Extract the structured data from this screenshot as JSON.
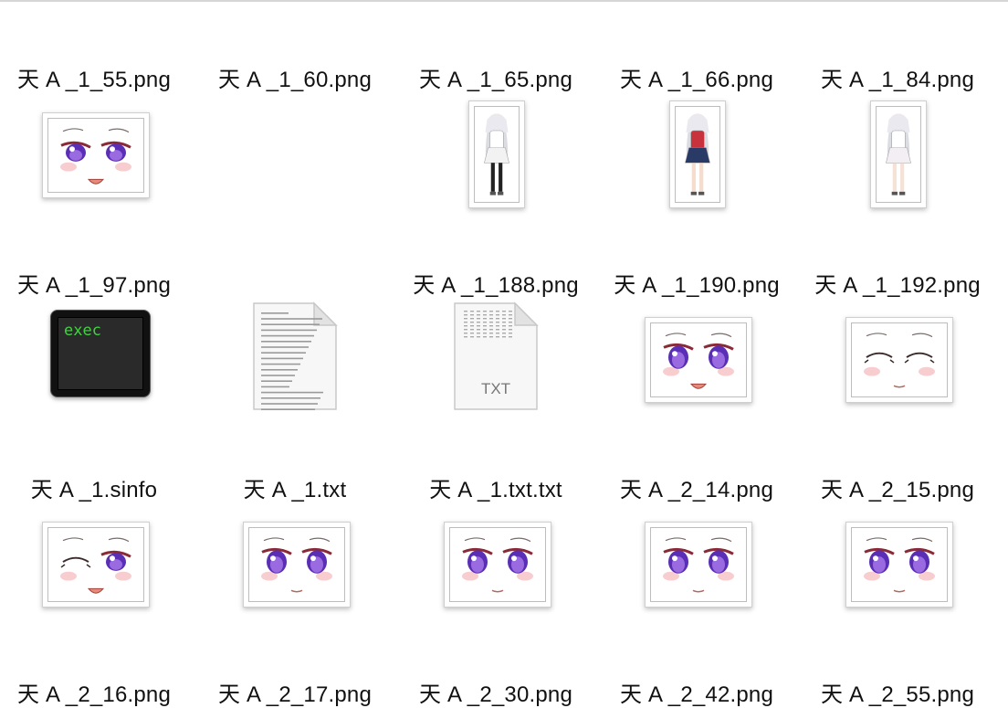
{
  "items": [
    {
      "label": "天 A _1_55.png",
      "kind": "face",
      "variant": "smile-open"
    },
    {
      "label": "天 A _1_60.png",
      "kind": "face",
      "variant": "smile-open"
    },
    {
      "label": "天 A _1_65.png",
      "kind": "face",
      "variant": "smile"
    },
    {
      "label": "天 A _1_66.png",
      "kind": "face",
      "variant": "smile-open"
    },
    {
      "label": "天 A _1_84.png",
      "kind": "face",
      "variant": "smile"
    },
    {
      "label": "天 A _1_97.png",
      "kind": "face",
      "variant": "half-lid"
    },
    {
      "label": "天 A _1_188.png",
      "kind": "figure",
      "variant": "white-dress"
    },
    {
      "label": "天 A _1_190.png",
      "kind": "figure",
      "variant": "red-jacket"
    },
    {
      "label": "天 A _1_192.png",
      "kind": "figure",
      "variant": "nightgown"
    },
    {
      "label": "天 A _1.sinfo",
      "kind": "terminal",
      "text": "exec"
    },
    {
      "label": "天 A _1.txt",
      "kind": "text-doc"
    },
    {
      "label": "天 A _1.txt.txt",
      "kind": "txt-doc",
      "tag": "TXT"
    },
    {
      "label": "天 A _2_14.png",
      "kind": "face",
      "variant": "open-mouth"
    },
    {
      "label": "天 A _2_15.png",
      "kind": "face",
      "variant": "wink"
    },
    {
      "label": "天 A _2_16.png",
      "kind": "face",
      "variant": "wink-open"
    },
    {
      "label": "天 A _2_17.png",
      "kind": "face",
      "variant": "open"
    },
    {
      "label": "天 A _2_30.png",
      "kind": "face",
      "variant": "open"
    },
    {
      "label": "天 A _2_42.png",
      "kind": "face",
      "variant": "open"
    },
    {
      "label": "天 A _2_55.png",
      "kind": "face",
      "variant": "open"
    }
  ],
  "colors": {
    "iris": "#5a2fb5",
    "iris_light": "#9a6be0",
    "blush": "#f6c4c8",
    "lid": "#8a2a36",
    "terminal_green": "#3fd43f"
  }
}
